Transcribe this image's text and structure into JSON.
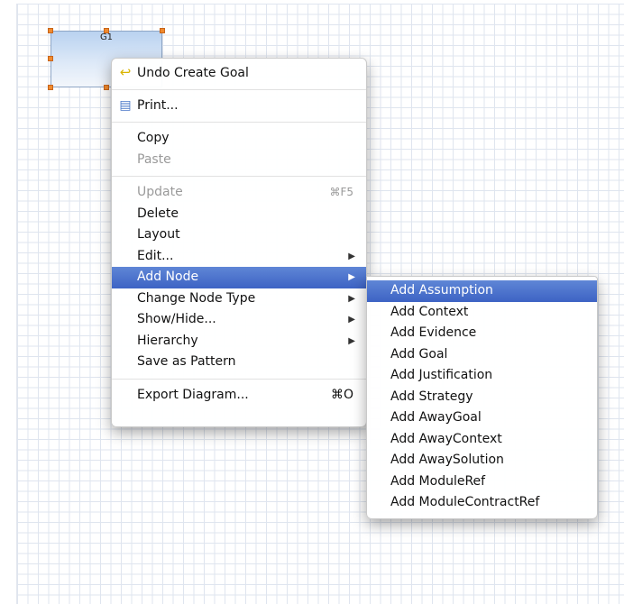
{
  "goal_node": {
    "label": "G1"
  },
  "main_menu": {
    "undo": {
      "label": "Undo Create Goal",
      "icon": "undo-icon"
    },
    "print": {
      "label": "Print...",
      "icon": "print-icon"
    },
    "copy": {
      "label": "Copy"
    },
    "paste": {
      "label": "Paste"
    },
    "update": {
      "label": "Update",
      "shortcut": "⌘F5"
    },
    "delete": {
      "label": "Delete"
    },
    "layout": {
      "label": "Layout"
    },
    "edit": {
      "label": "Edit..."
    },
    "add_node": {
      "label": "Add Node"
    },
    "change_node_type": {
      "label": "Change Node Type"
    },
    "show_hide": {
      "label": "Show/Hide..."
    },
    "hierarchy": {
      "label": "Hierarchy"
    },
    "save_as_pattern": {
      "label": "Save as Pattern"
    },
    "export_diagram": {
      "label": "Export Diagram...",
      "shortcut": "⌘O"
    }
  },
  "sub_menu": {
    "items": [
      "Add Assumption",
      "Add Context",
      "Add Evidence",
      "Add Goal",
      "Add Justification",
      "Add Strategy",
      "Add AwayGoal",
      "Add AwayContext",
      "Add AwaySolution",
      "Add ModuleRef",
      "Add ModuleContractRef"
    ]
  },
  "colors": {
    "selection": "#4a71cc",
    "handle": "#f08a2e",
    "grid": "#dfe5ef"
  }
}
